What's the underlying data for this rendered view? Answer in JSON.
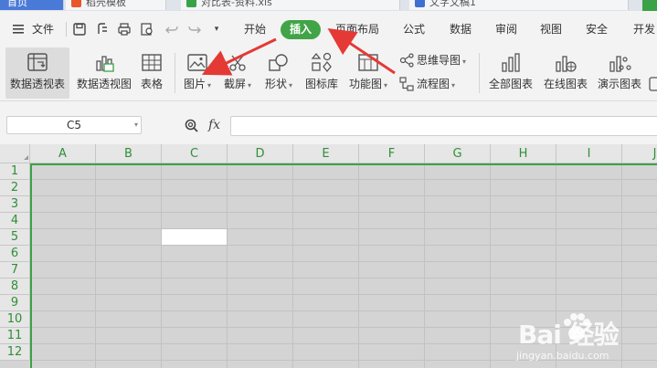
{
  "doc_tabs": [
    {
      "label": "首页",
      "icon": "home-tab"
    },
    {
      "label": "稻壳模板",
      "icon": "docer-icon"
    },
    {
      "label": "对比表-资料.xls",
      "icon": "sheet-file-icon"
    },
    {
      "label": "文字文稿1",
      "icon": "word-file-icon"
    }
  ],
  "menu": {
    "file": "文件",
    "tabs": [
      "开始",
      "插入",
      "页面布局",
      "公式",
      "数据",
      "审阅",
      "视图",
      "安全",
      "开发"
    ],
    "active_tab": "插入"
  },
  "ribbon": {
    "pivot_table": "数据透视表",
    "pivot_chart": "数据透视图",
    "table": "表格",
    "picture": "图片",
    "screenshot": "截屏",
    "shapes": "形状",
    "icon_library": "图标库",
    "function_chart": "功能图",
    "mind_map": "思维导图",
    "flowchart": "流程图",
    "all_charts": "全部图表",
    "online_charts": "在线图表",
    "demo_charts": "演示图表"
  },
  "formula_bar": {
    "name_box": "C5",
    "fx": "fx",
    "value": ""
  },
  "columns": [
    "A",
    "B",
    "C",
    "D",
    "E",
    "F",
    "G",
    "H",
    "I",
    "J"
  ],
  "rows": [
    "1",
    "2",
    "3",
    "4",
    "5",
    "6",
    "7",
    "8",
    "9",
    "10",
    "11",
    "12"
  ],
  "active_cell": "C5",
  "colors": {
    "accent": "#41a447",
    "annotation_arrow": "#e53935"
  },
  "watermark": {
    "brand": "Bai 经验",
    "url": "jingyan.baidu.com"
  }
}
